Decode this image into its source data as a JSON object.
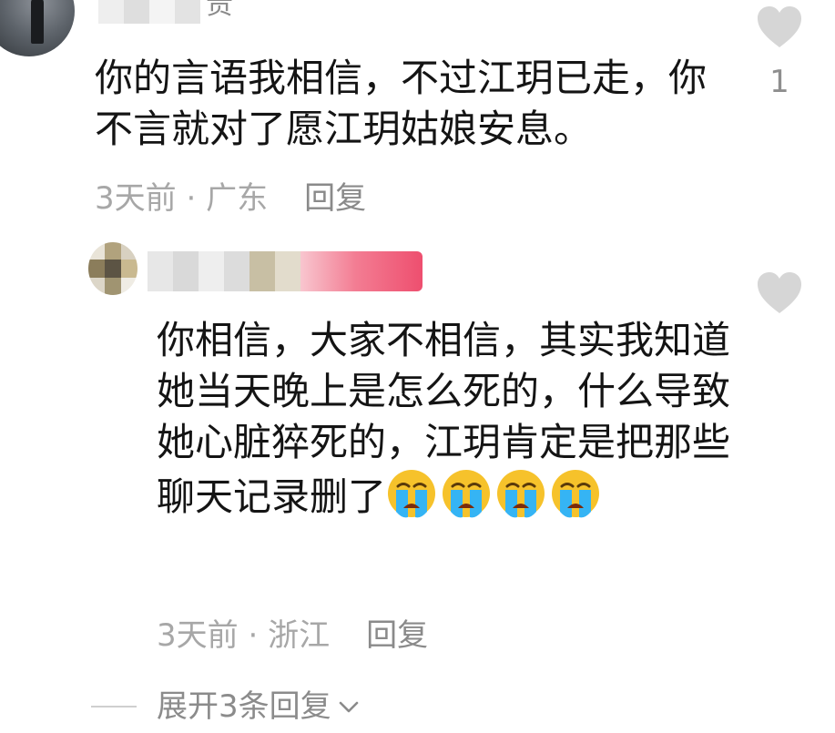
{
  "comment_1": {
    "username_visible": "贵",
    "text": "你的言语我相信，不过江玥已走，你不言就对了愿江玥姑娘安息。",
    "time": "3天前",
    "separator": " · ",
    "location": "广东",
    "reply_label": "回复",
    "like_count": "1",
    "like_icon": "heart-icon"
  },
  "comment_2": {
    "text": "你相信，大家不相信，其实我知道她当天晚上是怎么死的，什么导致她心脏猝死的，江玥肯定是把那些聊天记录删了",
    "emoji_name": "loudly-crying-face",
    "emoji_count": 4,
    "time": "3天前",
    "separator": " · ",
    "location": "浙江",
    "reply_label": "回复",
    "like_icon": "heart-icon"
  },
  "expand": {
    "label": "展开3条回复",
    "icon": "chevron-down-icon"
  },
  "colors": {
    "text": "#141414",
    "meta": "#a7a7a7",
    "heart": "#d6d6d6",
    "emoji_face": "#f6c22b",
    "emoji_tear": "#35b4f4"
  }
}
